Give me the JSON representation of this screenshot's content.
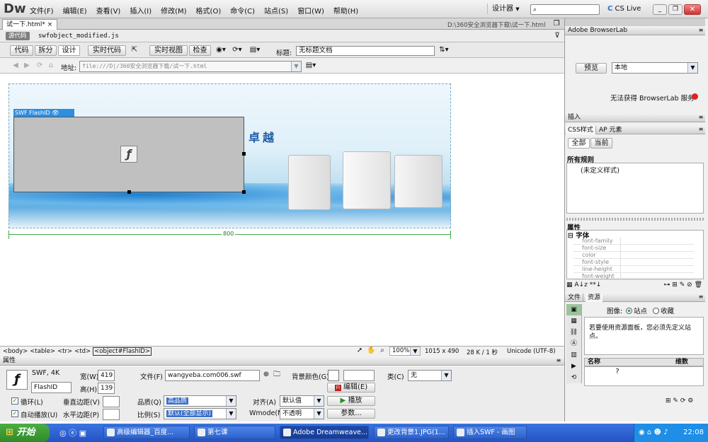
{
  "app": {
    "logo": "Dw",
    "menu": [
      "文件(F)",
      "编辑(E)",
      "查看(V)",
      "插入(I)",
      "修改(M)",
      "格式(O)",
      "命令(C)",
      "站点(S)",
      "窗口(W)",
      "帮助(H)"
    ],
    "workspace": "设计器",
    "cslive": "CS Live"
  },
  "doc": {
    "tab": "试一下.html*",
    "path": "D:\\360安全浏览器下载\\试一下.html",
    "source_badge": "源代码",
    "related_file": "swfobject_modified.js"
  },
  "toolbar": {
    "code": "代码",
    "split": "拆分",
    "design": "设计",
    "live_code": "实时代码",
    "live_view": "实时视图",
    "inspect": "检查",
    "title_label": "标题:",
    "title_value": "无标题文档"
  },
  "address": {
    "label": "地址:",
    "value": "file:///D|/360安全浏览器下载/试一下.html"
  },
  "canvas": {
    "swf_label": "SWF  FlashID",
    "banner_text": "卓越",
    "width_label": "800"
  },
  "status": {
    "tags": [
      "<body>",
      "<table>",
      "<tr>",
      "<td>",
      "<object#FlashID>"
    ],
    "zoom": "100%",
    "size": "1015 x 490",
    "weight": "28 K / 1 秒",
    "encoding": "Unicode (UTF-8)"
  },
  "props": {
    "header": "属性",
    "type": "SWF, 4K",
    "id": "FlashID",
    "width_label": "宽(W)",
    "width": "419",
    "height_label": "高(H)",
    "height": "139",
    "file_label": "文件(F)",
    "file": "wangyeba.com006.swf",
    "bg_label": "背景颜色(G)",
    "class_label": "类(C)",
    "class_value": "无",
    "edit": "编辑(E)",
    "loop": "循环(L)",
    "autoplay": "自动播放(U)",
    "vspace": "垂直边距(V)",
    "hspace": "水平边距(P)",
    "quality_label": "品质(Q)",
    "quality": "高品质",
    "scale_label": "比例(S)",
    "scale": "默认(全部显示)",
    "align_label": "对齐(A)",
    "align": "默认值",
    "wmode_label": "Wmode(M)",
    "wmode": "不透明",
    "play": "播放",
    "params": "参数..."
  },
  "right": {
    "browserlab_title": "Adobe BrowserLab",
    "preview": "预览",
    "local": "本地",
    "browserlab_status": "无法获得 BrowserLab 服务",
    "insert": "插入",
    "css_tab": "CSS样式",
    "ap_tab": "AP 元素",
    "all": "全部",
    "current": "当前",
    "all_rules": "所有规则",
    "undefined_style": "(未定义样式)",
    "properties": "属性",
    "font_group": "字体",
    "font_props": [
      "font-family",
      "font-size",
      "color",
      "font-style",
      "line-height",
      "font-weight"
    ],
    "files_tab": "文件",
    "assets_tab": "资源",
    "image_label": "图像:",
    "site": "站点",
    "favorites": "收藏",
    "assets_msg": "若要使用资源面板，您必须先定义站点。",
    "col_name": "名称",
    "col_dim": "维数"
  },
  "taskbar": {
    "start": "开始",
    "items": [
      "高级编辑器_百度...",
      "第七课",
      "Adobe Dreamweave...",
      "更改背景1.JPG(1...",
      "插入SWF - 画图"
    ],
    "time": "22:08"
  },
  "colors": {
    "title_bar": "#e9e9e9",
    "taskbar": "#2f63cf",
    "start": "#3d9b35",
    "swf_placeholder": "#c0c0c0",
    "accent_blue": "#1f5ba8"
  }
}
